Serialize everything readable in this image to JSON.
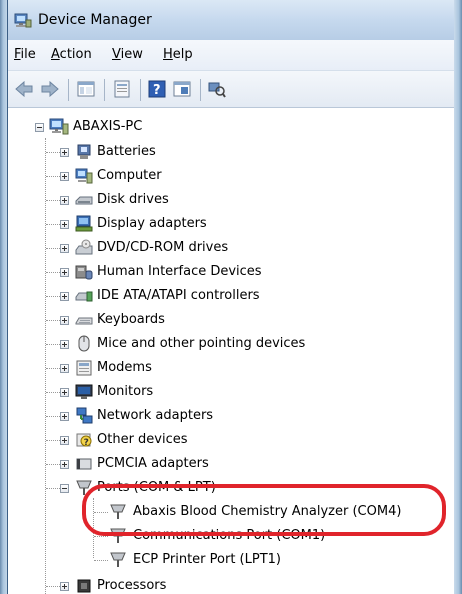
{
  "window": {
    "title": "Device Manager"
  },
  "menu": [
    {
      "label": "File",
      "hotkey": "F",
      "rest": "ile"
    },
    {
      "label": "Action",
      "hotkey": "A",
      "rest": "ction"
    },
    {
      "label": "View",
      "hotkey": "V",
      "rest": "iew"
    },
    {
      "label": "Help",
      "hotkey": "H",
      "rest": "elp"
    }
  ],
  "toolbar": [
    "back-arrow-icon",
    "forward-arrow-icon",
    "show-hide-console-tree-icon",
    "properties-icon",
    "help-icon",
    "update-driver-icon",
    "scan-hardware-icon"
  ],
  "tree": {
    "root": "ABAXIS-PC",
    "categories": [
      "Batteries",
      "Computer",
      "Disk drives",
      "Display adapters",
      "DVD/CD-ROM drives",
      "Human Interface Devices",
      "IDE ATA/ATAPI controllers",
      "Keyboards",
      "Mice and other pointing devices",
      "Modems",
      "Monitors",
      "Network adapters",
      "Other devices",
      "PCMCIA adapters",
      "Ports (COM & LPT)"
    ],
    "ports_children": [
      "Abaxis Blood Chemistry Analyzer (COM4)",
      "Communications Port (COM1)",
      "ECP Printer Port (LPT1)"
    ],
    "after": "Processors"
  },
  "highlight_color": "#e0242b"
}
